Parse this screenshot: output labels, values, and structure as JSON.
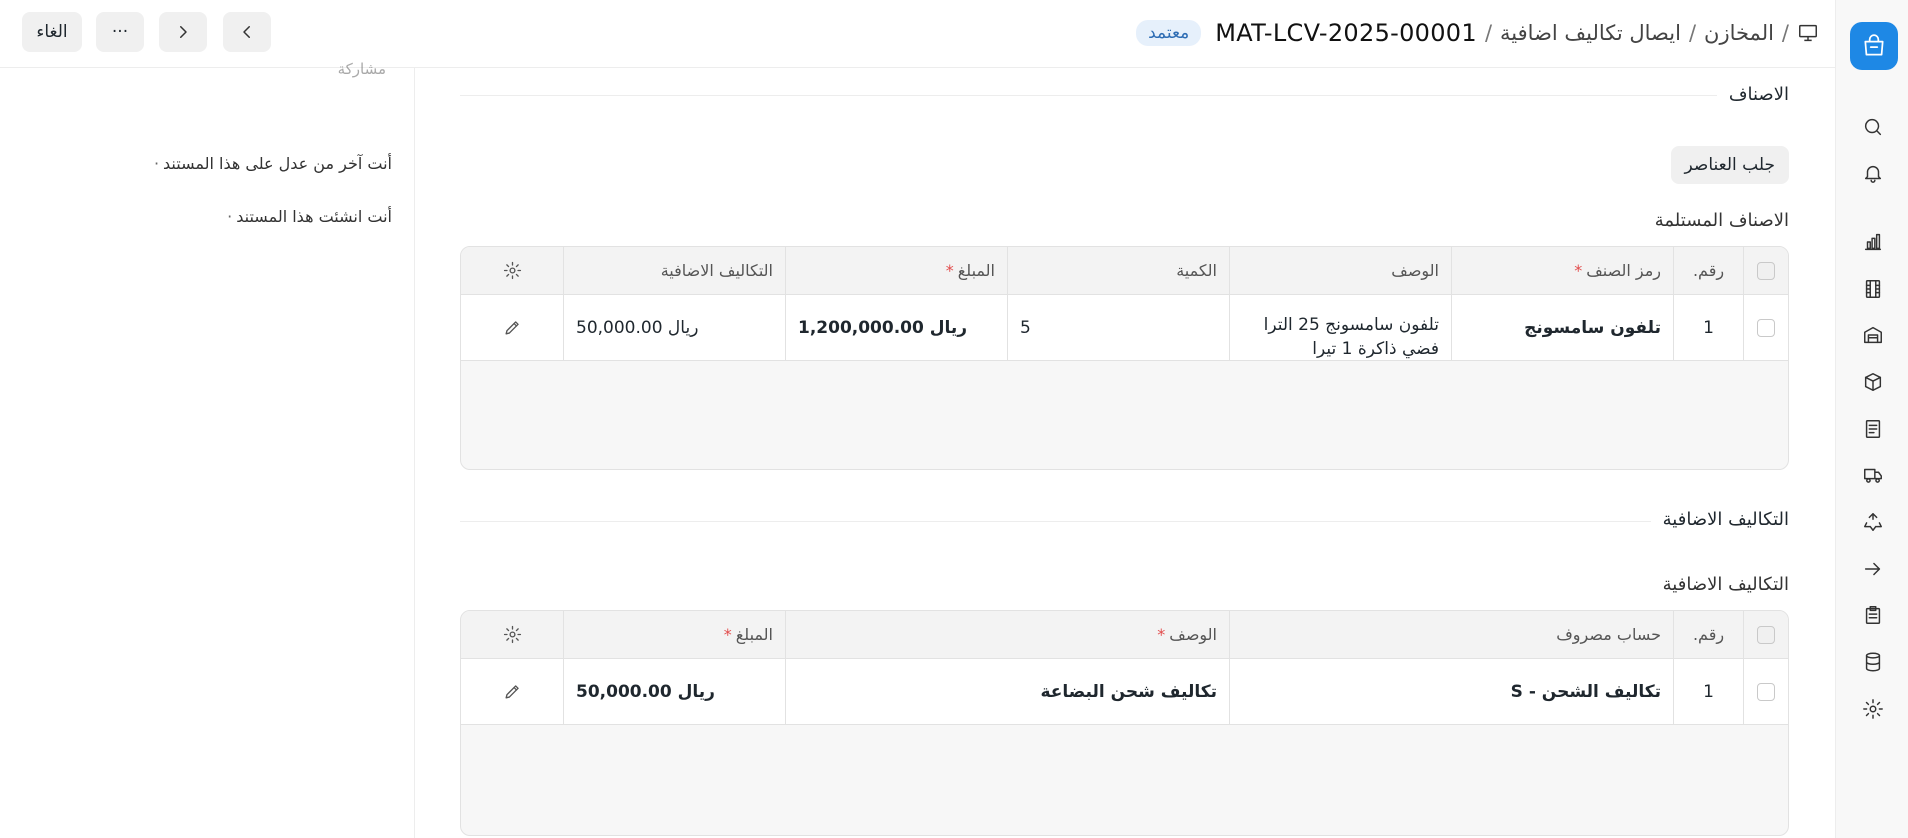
{
  "topbar": {
    "breadcrumb_1": "المخازن",
    "breadcrumb_2": "ايصال تكاليف اضافية",
    "sep": "/",
    "doc_id": "MAT-LCV-2025-00001",
    "status": "معتمد",
    "cancel_label": "الغاء",
    "more_label": "···"
  },
  "side": {
    "cut_text": "مشاركة",
    "activity_1": "أنت آخر من عدل على هذا المستند",
    "activity_2": "أنت انشئت هذا المستند",
    "dot": "·"
  },
  "items_section": {
    "heading": "الاصناف",
    "get_items_label": "جلب العناصر",
    "table_label": "الاصناف المستلمة",
    "columns": {
      "no": "رقم.",
      "item_code": "رمز الصنف",
      "description": "الوصف",
      "qty": "الكمية",
      "amount": "المبلغ",
      "additional_costs": "التكاليف الاضافية"
    },
    "rows": [
      {
        "no": "1",
        "item_code": "تلفون سامسونج",
        "description": "تلفون سامسونج 25 الترا فضي ذاكرة 1 تيرا",
        "qty": "5",
        "amount": "ريال 1,200,000.00",
        "additional_costs": "ريال 50,000.00"
      }
    ]
  },
  "charges_section": {
    "heading": "التكاليف الاضافية",
    "table_label": "التكاليف الاضافية",
    "columns": {
      "no": "رقم.",
      "expense_account": "حساب مصروف",
      "description": "الوصف",
      "amount": "المبلغ"
    },
    "rows": [
      {
        "no": "1",
        "expense_account": "تكاليف الشحن - S",
        "description": "تكاليف شحن البضاعة",
        "amount": "ريال 50,000.00"
      }
    ]
  },
  "rail_icons": [
    "app-logo-icon",
    "search-icon",
    "bell-icon",
    "chart-icon",
    "film-icon",
    "warehouse-icon",
    "box-icon",
    "document-icon",
    "truck-icon",
    "recycle-icon",
    "arrow-right-icon",
    "clipboard-icon",
    "database-icon",
    "gear-icon"
  ],
  "colors": {
    "accent": "#1e88e5",
    "badge_bg": "#e6f0fb",
    "badge_text": "#2e6db4",
    "required": "#e24c4c"
  }
}
